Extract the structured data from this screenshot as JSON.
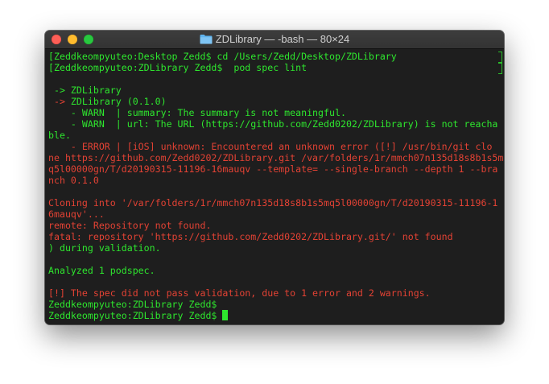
{
  "window": {
    "title": "ZDLibrary — -bash — 80×24",
    "folder_icon": "folder-icon",
    "colors": {
      "prompt_green": "#2ee62e",
      "error_red": "#e34234",
      "background": "#1e1e1e"
    }
  },
  "terminal": {
    "lines": [
      {
        "text": "[Zeddkeompyuteo:Desktop Zedd$ cd /Users/Zedd/Desktop/ZDLibrary",
        "color": "g"
      },
      {
        "text": "[Zeddkeompyuteo:ZDLibrary Zedd$  pod spec lint",
        "color": "g"
      },
      {
        "text": "",
        "color": "g"
      },
      {
        "text": " -> ZDLibrary",
        "color": "g"
      },
      {
        "text": " -> ZDLibrary (0.1.0)",
        "color": "rg"
      },
      {
        "text": "    - WARN  | summary: The summary is not meaningful.",
        "color": "g"
      },
      {
        "text": "    - WARN  | url: The URL (https://github.com/Zedd0202/ZDLibrary) is not reacha",
        "color": "g"
      },
      {
        "text": "ble.",
        "color": "g"
      },
      {
        "text": "    - ERROR | [iOS] unknown: Encountered an unknown error ([!] /usr/bin/git clo",
        "color": "r"
      },
      {
        "text": "ne https://github.com/Zedd0202/ZDLibrary.git /var/folders/1r/mmch07n135d18s8b1s5m",
        "color": "r"
      },
      {
        "text": "q5l00000gn/T/d20190315-11196-16mauqv --template= --single-branch --depth 1 --bra",
        "color": "r"
      },
      {
        "text": "nch 0.1.0",
        "color": "r"
      },
      {
        "text": "",
        "color": "r"
      },
      {
        "text": "Cloning into '/var/folders/1r/mmch07n135d18s8b1s5mq5l00000gn/T/d20190315-11196-1",
        "color": "r"
      },
      {
        "text": "6mauqv'...",
        "color": "r"
      },
      {
        "text": "remote: Repository not found.",
        "color": "r"
      },
      {
        "text": "fatal: repository 'https://github.com/Zedd0202/ZDLibrary.git/' not found",
        "color": "r"
      },
      {
        "text": ") during validation.",
        "color": "g"
      },
      {
        "text": "",
        "color": "g"
      },
      {
        "text": "Analyzed 1 podspec.",
        "color": "g"
      },
      {
        "text": "",
        "color": "g"
      },
      {
        "text": "[!] The spec did not pass validation, due to 1 error and 2 warnings.",
        "color": "r"
      },
      {
        "text": "Zeddkeompyuteo:ZDLibrary Zedd$",
        "color": "g"
      },
      {
        "text": "Zeddkeompyuteo:ZDLibrary Zedd$ ",
        "color": "g"
      }
    ]
  }
}
